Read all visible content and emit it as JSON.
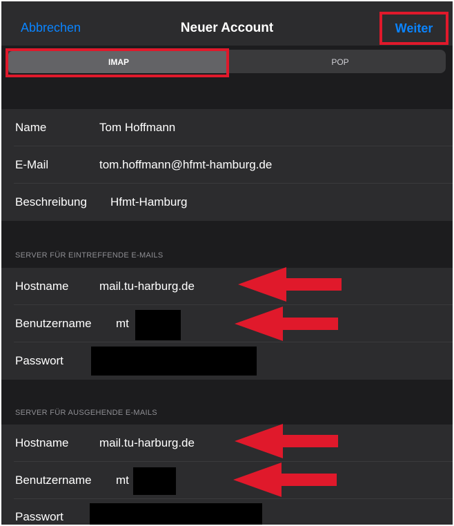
{
  "nav": {
    "cancel": "Abbrechen",
    "title": "Neuer Account",
    "next": "Weiter"
  },
  "segments": {
    "imap": "IMAP",
    "pop": "POP",
    "selected": "IMAP"
  },
  "account": {
    "name_label": "Name",
    "name_value": "Tom Hoffmann",
    "email_label": "E-Mail",
    "email_value": "tom.hoffmann@hfmt-hamburg.de",
    "description_label": "Beschreibung",
    "description_value": "Hfmt-Hamburg"
  },
  "incoming": {
    "header": "SERVER FÜR EINTREFFENDE E-MAILS",
    "hostname_label": "Hostname",
    "hostname_value": "mail.tu-harburg.de",
    "username_label": "Benutzername",
    "username_value": "mt",
    "password_label": "Passwort"
  },
  "outgoing": {
    "header": "SERVER FÜR AUSGEHENDE E-MAILS",
    "hostname_label": "Hostname",
    "hostname_value": "mail.tu-harburg.de",
    "username_label": "Benutzername",
    "username_value": "mt",
    "password_label": "Passwort"
  },
  "colors": {
    "accent": "#0a84ff",
    "annotation": "#e0192b",
    "row_background": "#2c2c2e",
    "screen_background": "#1c1c1e"
  }
}
